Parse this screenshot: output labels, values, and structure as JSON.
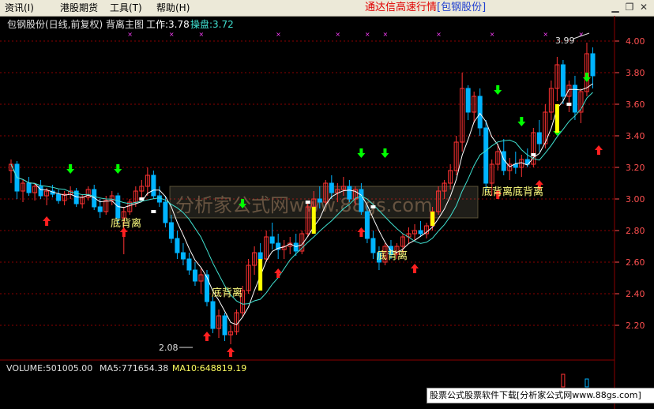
{
  "menu": {
    "items": [
      {
        "label": "资讯(I)"
      },
      {
        "label": "港股期货"
      },
      {
        "label": "工具(T)"
      },
      {
        "label": "帮助(H)"
      }
    ]
  },
  "app_title": {
    "text": "通达信高速行情",
    "instrument": "[包钢股份]"
  },
  "chart_header": {
    "title": "包钢股份(日线,前复权) 背离主图",
    "work_label": "工作:3.78",
    "op_label": "操盘:3.72"
  },
  "colors": {
    "background": "#000000",
    "up_candle": "#ff3232",
    "down_candle": "#00b4ff",
    "signal_candle": "#ffff00",
    "ma_fast": "#ffffff",
    "ma_slow": "#40e0d0",
    "grid": "#8b0000",
    "arrow_up": "#ff2020",
    "arrow_down": "#00ff00",
    "axis_text": "#ff5050",
    "label_text": "#ffff80"
  },
  "price_axis": {
    "ticks": [
      "4.00",
      "3.80",
      "3.60",
      "3.40",
      "3.20",
      "3.00",
      "2.80",
      "2.60",
      "2.40",
      "2.20"
    ]
  },
  "annotations": {
    "low_marker": "2.08",
    "high_marker": "3.99",
    "divergence_label": "底背离",
    "divergence_label_double": "底背离底背离"
  },
  "watermark": "分析家公式网www.88gs.com",
  "volume_panel": {
    "volume": "VOLUME:501005.00",
    "ma5": "MA5:771654.38",
    "ma10": "MA10:648819.19"
  },
  "footer_banner": "股票公式股票软件下载[分析家公式网www.88gs.com]",
  "chart_data": {
    "type": "candlestick",
    "title": "包钢股份(日线,前复权) 背离主图",
    "ylim": [
      2.05,
      4.05
    ],
    "price_ticks": [
      4.0,
      3.8,
      3.6,
      3.4,
      3.2,
      3.0,
      2.8,
      2.6,
      2.4,
      2.2
    ],
    "low": 2.08,
    "high": 3.99,
    "candles": [
      [
        3.18,
        3.25,
        3.1,
        3.22
      ],
      [
        3.22,
        3.24,
        3.0,
        3.05
      ],
      [
        3.05,
        3.12,
        2.98,
        3.1
      ],
      [
        3.1,
        3.14,
        3.02,
        3.04
      ],
      [
        3.04,
        3.1,
        2.99,
        3.08
      ],
      [
        3.08,
        3.12,
        3.0,
        3.02
      ],
      [
        3.02,
        3.07,
        2.96,
        3.05
      ],
      [
        3.05,
        3.09,
        3.01,
        3.03
      ],
      [
        3.03,
        3.06,
        2.97,
        2.99
      ],
      [
        2.99,
        3.05,
        2.96,
        3.03
      ],
      [
        3.03,
        3.08,
        3.0,
        3.05
      ],
      [
        3.05,
        3.07,
        2.95,
        2.97
      ],
      [
        2.97,
        3.03,
        2.94,
        3.01
      ],
      [
        3.01,
        3.08,
        2.99,
        3.06
      ],
      [
        3.06,
        3.09,
        2.93,
        2.95
      ],
      [
        2.95,
        3.0,
        2.88,
        2.92
      ],
      [
        2.92,
        3.02,
        2.9,
        2.99
      ],
      [
        2.99,
        3.05,
        2.96,
        3.02
      ],
      [
        3.02,
        3.04,
        2.85,
        2.88
      ],
      [
        2.88,
        2.95,
        2.65,
        2.92
      ],
      [
        2.92,
        3.0,
        2.9,
        2.98
      ],
      [
        2.98,
        3.08,
        2.95,
        3.05
      ],
      [
        3.05,
        3.12,
        3.0,
        3.08
      ],
      [
        3.08,
        3.2,
        3.02,
        3.15
      ],
      [
        3.15,
        3.18,
        3.0,
        3.02
      ],
      [
        3.02,
        3.08,
        2.95,
        2.98
      ],
      [
        2.98,
        3.02,
        2.82,
        2.85
      ],
      [
        2.85,
        2.9,
        2.72,
        2.75
      ],
      [
        2.75,
        2.8,
        2.62,
        2.66
      ],
      [
        2.66,
        2.72,
        2.58,
        2.62
      ],
      [
        2.62,
        2.66,
        2.52,
        2.55
      ],
      [
        2.55,
        2.6,
        2.45,
        2.48
      ],
      [
        2.48,
        2.56,
        2.4,
        2.52
      ],
      [
        2.52,
        2.55,
        2.32,
        2.35
      ],
      [
        2.35,
        2.38,
        2.15,
        2.18
      ],
      [
        2.18,
        2.3,
        2.12,
        2.26
      ],
      [
        2.26,
        2.28,
        2.1,
        2.14
      ],
      [
        2.14,
        2.2,
        2.08,
        2.16
      ],
      [
        2.16,
        2.3,
        2.14,
        2.28
      ],
      [
        2.28,
        2.45,
        2.25,
        2.42
      ],
      [
        2.42,
        2.62,
        2.4,
        2.58
      ],
      [
        2.58,
        2.7,
        2.52,
        2.66
      ],
      [
        2.66,
        2.72,
        2.58,
        2.62
      ],
      [
        2.62,
        2.8,
        2.6,
        2.76
      ],
      [
        2.76,
        2.85,
        2.68,
        2.72
      ],
      [
        2.72,
        2.78,
        2.62,
        2.68
      ],
      [
        2.68,
        2.74,
        2.62,
        2.7
      ],
      [
        2.7,
        2.76,
        2.65,
        2.72
      ],
      [
        2.72,
        2.78,
        2.64,
        2.67
      ],
      [
        2.67,
        2.8,
        2.65,
        2.78
      ],
      [
        2.78,
        2.98,
        2.76,
        2.95
      ],
      [
        2.95,
        3.05,
        2.9,
        3.0
      ],
      [
        3.0,
        3.08,
        2.94,
        2.98
      ],
      [
        2.98,
        3.12,
        2.96,
        3.1
      ],
      [
        3.1,
        3.15,
        3.0,
        3.04
      ],
      [
        3.04,
        3.1,
        2.98,
        3.06
      ],
      [
        3.06,
        3.14,
        3.02,
        3.08
      ],
      [
        3.08,
        3.12,
        2.98,
        3.0
      ],
      [
        3.0,
        3.08,
        2.96,
        3.06
      ],
      [
        3.06,
        3.1,
        2.9,
        2.92
      ],
      [
        2.92,
        2.96,
        2.72,
        2.75
      ],
      [
        2.75,
        2.8,
        2.62,
        2.66
      ],
      [
        2.66,
        2.7,
        2.55,
        2.6
      ],
      [
        2.6,
        2.72,
        2.58,
        2.7
      ],
      [
        2.7,
        2.74,
        2.62,
        2.65
      ],
      [
        2.65,
        2.72,
        2.62,
        2.7
      ],
      [
        2.7,
        2.78,
        2.66,
        2.76
      ],
      [
        2.76,
        2.82,
        2.72,
        2.78
      ],
      [
        2.78,
        2.84,
        2.74,
        2.8
      ],
      [
        2.8,
        2.86,
        2.76,
        2.78
      ],
      [
        2.78,
        2.85,
        2.75,
        2.83
      ],
      [
        2.83,
        2.95,
        2.8,
        2.92
      ],
      [
        2.92,
        3.08,
        2.9,
        3.05
      ],
      [
        3.05,
        3.12,
        3.0,
        3.1
      ],
      [
        3.1,
        3.22,
        3.06,
        3.18
      ],
      [
        3.18,
        3.4,
        3.15,
        3.36
      ],
      [
        3.36,
        3.8,
        3.3,
        3.7
      ],
      [
        3.7,
        3.72,
        3.5,
        3.55
      ],
      [
        3.55,
        3.68,
        3.48,
        3.65
      ],
      [
        3.65,
        3.7,
        3.4,
        3.45
      ],
      [
        3.45,
        3.5,
        3.05,
        3.1
      ],
      [
        3.1,
        3.25,
        3.02,
        3.22
      ],
      [
        3.22,
        3.35,
        3.18,
        3.3
      ],
      [
        3.3,
        3.38,
        3.15,
        3.18
      ],
      [
        3.18,
        3.26,
        3.12,
        3.22
      ],
      [
        3.22,
        3.3,
        3.16,
        3.2
      ],
      [
        3.2,
        3.28,
        3.14,
        3.25
      ],
      [
        3.25,
        3.32,
        3.2,
        3.22
      ],
      [
        3.22,
        3.45,
        3.2,
        3.42
      ],
      [
        3.42,
        3.5,
        3.3,
        3.35
      ],
      [
        3.35,
        3.6,
        3.32,
        3.55
      ],
      [
        3.55,
        3.75,
        3.5,
        3.7
      ],
      [
        3.7,
        3.9,
        3.62,
        3.85
      ],
      [
        3.85,
        3.88,
        3.6,
        3.65
      ],
      [
        3.65,
        3.75,
        3.55,
        3.72
      ],
      [
        3.72,
        3.78,
        3.5,
        3.55
      ],
      [
        3.55,
        3.7,
        3.48,
        3.68
      ],
      [
        3.68,
        3.99,
        3.65,
        3.92
      ],
      [
        3.92,
        3.96,
        3.7,
        3.78
      ]
    ]
  }
}
